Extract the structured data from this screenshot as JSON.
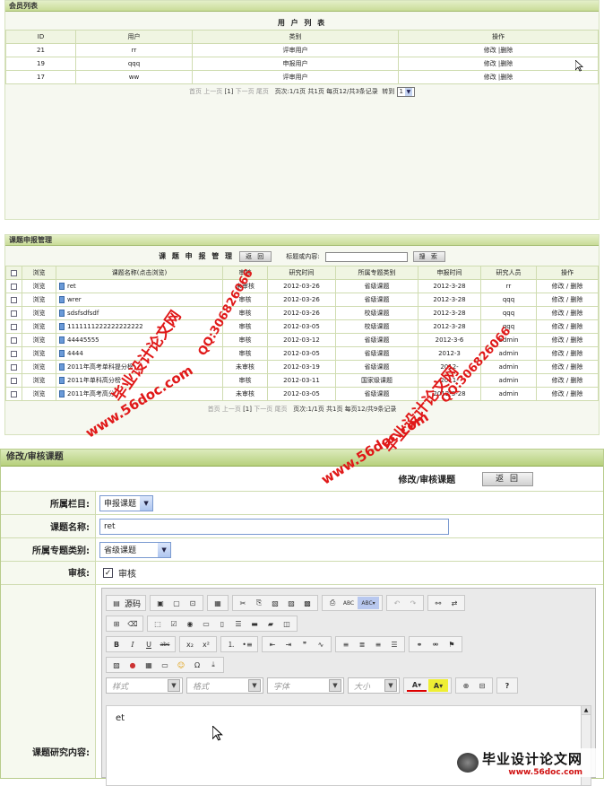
{
  "members": {
    "header": "会员列表",
    "title": "用 户 列 表",
    "columns": [
      "ID",
      "用户",
      "类别",
      "操作"
    ],
    "rows": [
      {
        "id": "21",
        "user": "rr",
        "type": "评审用户",
        "ops": "修改 |删除"
      },
      {
        "id": "19",
        "user": "qqq",
        "type": "申报用户",
        "ops": "修改 |删除"
      },
      {
        "id": "17",
        "user": "ww",
        "type": "评审用户",
        "ops": "修改 |删除"
      }
    ],
    "pager": {
      "first": "首页",
      "prev": "上一页",
      "cur": "[1]",
      "next": "下一页",
      "last": "尾页",
      "info": "页次:1/1页 共1页 每页12/共3条记录",
      "goto": "转到",
      "page": "1"
    }
  },
  "projects": {
    "header": "课题申报管理",
    "title": "课 题 申 报 管 理",
    "back": "返 回",
    "search_label": "标题或内容:",
    "search_value": "",
    "search_btn": "搜 索",
    "columns": [
      "",
      "浏览",
      "课题名称(点击浏览)",
      "审核",
      "研究时间",
      "所属专题类别",
      "申报时间",
      "研究人员",
      "操作"
    ],
    "rows": [
      {
        "view": "浏览",
        "name": "ret",
        "audit": "未审核",
        "time": "2012-03-26",
        "cat": "省级课题",
        "date": "2012-3-28",
        "person": "rr",
        "ops": "修改 / 删除"
      },
      {
        "view": "浏览",
        "name": "wrer",
        "audit": "审核",
        "time": "2012-03-26",
        "cat": "省级课题",
        "date": "2012-3-28",
        "person": "qqq",
        "ops": "修改 / 删除"
      },
      {
        "view": "浏览",
        "name": "sdsfsdfsdf",
        "audit": "审核",
        "time": "2012-03-26",
        "cat": "校级课题",
        "date": "2012-3-28",
        "person": "qqq",
        "ops": "修改 / 删除"
      },
      {
        "view": "浏览",
        "name": "1111111222222222222",
        "audit": "审核",
        "time": "2012-03-05",
        "cat": "校级课题",
        "date": "2012-3-28",
        "person": "qqq",
        "ops": "修改 / 删除"
      },
      {
        "view": "浏览",
        "name": "44445555",
        "audit": "审核",
        "time": "2012-03-12",
        "cat": "省级课题",
        "date": "2012-3-6",
        "person": "admin",
        "ops": "修改 / 删除"
      },
      {
        "view": "浏览",
        "name": "4444",
        "audit": "审核",
        "time": "2012-03-05",
        "cat": "省级课题",
        "date": "2012-3",
        "person": "admin",
        "ops": "修改 / 删除"
      },
      {
        "view": "浏览",
        "name": "2011年高考单科提分榜",
        "audit": "未审核",
        "time": "2012-03-19",
        "cat": "省级课题",
        "date": "2012-",
        "person": "admin",
        "ops": "修改 / 删除"
      },
      {
        "view": "浏览",
        "name": "2011年单科高分榜",
        "audit": "审核",
        "time": "2012-03-11",
        "cat": "国家级课题",
        "date": "2011-",
        "person": "admin",
        "ops": "修改 / 删除"
      },
      {
        "view": "浏览",
        "name": "2011年高考高分",
        "audit": "未审核",
        "time": "2012-03-05",
        "cat": "省级课题",
        "date": "2012-3-28",
        "person": "admin",
        "ops": "修改 / 删除"
      }
    ],
    "pager": {
      "first": "首页",
      "prev": "上一页",
      "cur": "[1]",
      "next": "下一页",
      "last": "尾页",
      "info": "页次:1/1页 共1页 每页12/共9条记录"
    }
  },
  "edit": {
    "header": "修改/审核课题",
    "subtitle": "修改/审核课题",
    "back": "返 回",
    "column_label": "所属栏目:",
    "column_value": "申报课题",
    "name_label": "课题名称:",
    "name_value": "ret",
    "cat_label": "所属专题类别:",
    "cat_value": "省级课题",
    "audit_label": "审核:",
    "audit_text": "审核",
    "content_label": "课题研究内容:",
    "content_value": "et",
    "toolbar": {
      "source": "源码",
      "style": "样式",
      "format": "格式",
      "font": "字体",
      "size": "大小"
    }
  },
  "watermarks": {
    "site": "www.56doc.com",
    "qq": "QQ:306826066",
    "name": "毕业设计论文网",
    "corner_name": "毕业设计论文网",
    "corner_url": "www.56doc.com"
  },
  "colors": {
    "header_green": "#c9dc98",
    "watermark_red": "#e01818"
  }
}
